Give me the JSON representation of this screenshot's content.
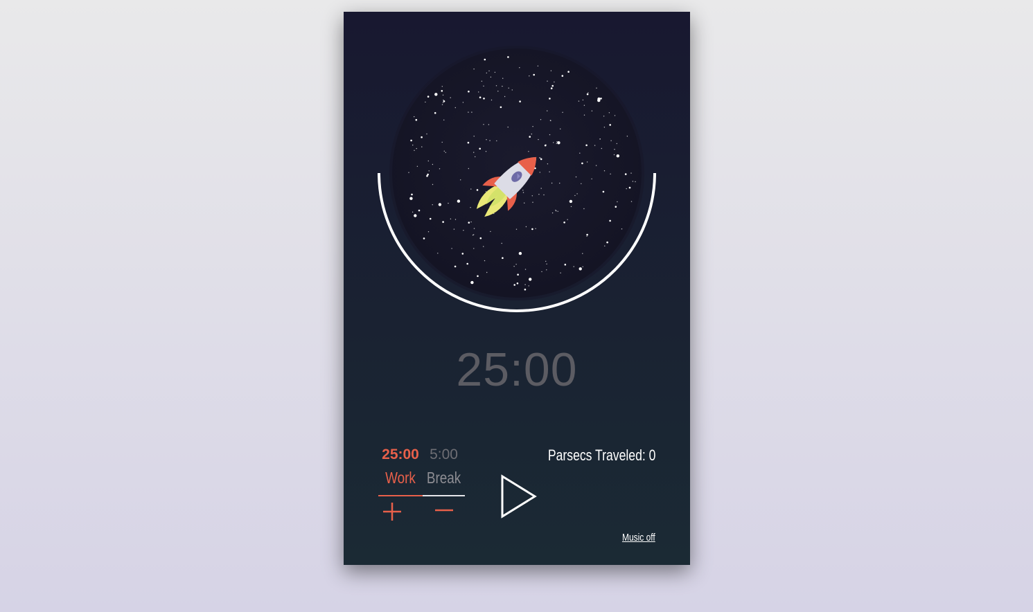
{
  "timer": {
    "display": "25:00",
    "progress_fraction": 0.5
  },
  "modes": [
    {
      "time": "25:00",
      "label": "Work",
      "active": true
    },
    {
      "time": "5:00",
      "label": "Break",
      "active": false
    }
  ],
  "controls": {
    "increment_icon": "plus-icon",
    "decrement_icon": "minus-icon",
    "play_icon": "play-icon"
  },
  "stats": {
    "parsecs_label": "Parsecs Traveled: 0"
  },
  "music": {
    "toggle_label": "Music off"
  },
  "colors": {
    "accent": "#e8604a",
    "muted": "#8d8d93",
    "progress_ring": "#ffffff",
    "space": "#161627"
  }
}
